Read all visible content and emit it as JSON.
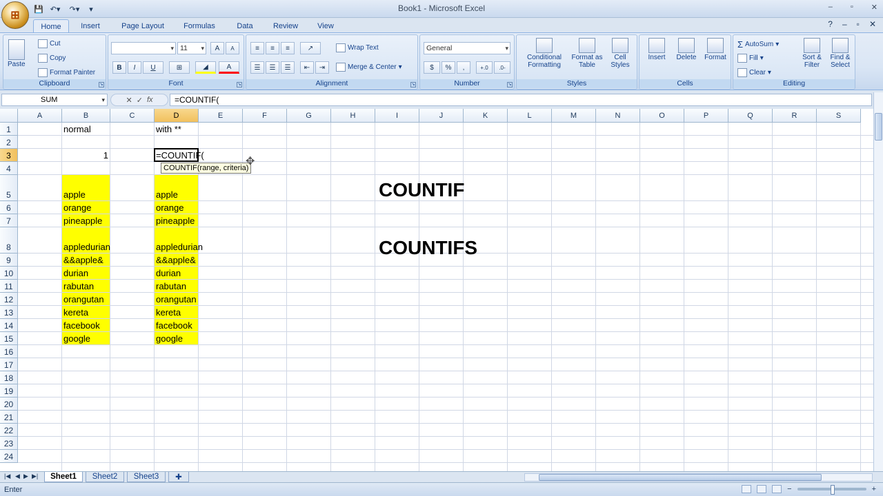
{
  "window": {
    "title": "Book1 - Microsoft Excel",
    "minimize": "–",
    "maximize": "▫",
    "close": "✕"
  },
  "office_button": "⊞",
  "qat": {
    "save": "💾",
    "undo": "↶▾",
    "redo": "↷▾",
    "more": "▾"
  },
  "tabs": [
    "Home",
    "Insert",
    "Page Layout",
    "Formulas",
    "Data",
    "Review",
    "View"
  ],
  "active_tab": "Home",
  "help_icons": {
    "help": "?",
    "min": "–",
    "restore": "▫",
    "close": "✕"
  },
  "ribbon": {
    "clipboard": {
      "label": "Clipboard",
      "paste": "Paste",
      "cut": "Cut",
      "copy": "Copy",
      "format_painter": "Format Painter"
    },
    "font": {
      "label": "Font",
      "font_name": "",
      "font_size": "11",
      "grow": "A",
      "shrink": "A",
      "bold": "B",
      "italic": "I",
      "underline": "U",
      "borders": "⊞",
      "fill": "◢",
      "font_color": "A"
    },
    "alignment": {
      "label": "Alignment",
      "wrap_text": "Wrap Text",
      "merge_center": "Merge & Center"
    },
    "number": {
      "label": "Number",
      "format": "General",
      "currency": "$",
      "percent": "%",
      "comma": ",",
      "inc_decimal": "+.0",
      "dec_decimal": ".0-"
    },
    "styles": {
      "label": "Styles",
      "conditional": "Conditional Formatting",
      "format_table": "Format as Table",
      "cell_styles": "Cell Styles"
    },
    "cells": {
      "label": "Cells",
      "insert": "Insert",
      "delete": "Delete",
      "format": "Format"
    },
    "editing": {
      "label": "Editing",
      "autosum": "AutoSum",
      "fill": "Fill",
      "clear": "Clear",
      "sort_filter": "Sort & Filter",
      "find_select": "Find & Select"
    }
  },
  "formula_bar": {
    "name_box": "SUM",
    "fx_cancel": "✕",
    "fx_enter": "✓",
    "fx_insert": "fx",
    "formula": "=COUNTIF("
  },
  "columns": [
    "A",
    "B",
    "C",
    "D",
    "E",
    "F",
    "G",
    "H",
    "I",
    "J",
    "K",
    "L",
    "M",
    "N",
    "O",
    "P",
    "Q",
    "R",
    "S"
  ],
  "rows": [
    "1",
    "2",
    "3",
    "4",
    "5",
    "6",
    "7",
    "8",
    "9",
    "10",
    "11",
    "12",
    "13",
    "14",
    "15",
    "16",
    "17",
    "18",
    "19",
    "20",
    "21",
    "22",
    "23",
    "24"
  ],
  "cells": {
    "B1": "normal",
    "D1": "with **",
    "B3": "1",
    "D3": "=COUNTIF(",
    "fruits_b": [
      "apple",
      "orange",
      "pineapple",
      "appledurian",
      "&&apple&",
      "durian",
      "rabutan",
      "orangutan",
      "kereta",
      "facebook",
      "google"
    ],
    "fruits_d": [
      "apple",
      "orange",
      "pineapple",
      "appledurian",
      "&&apple&",
      "durian",
      "rabutan",
      "orangutan",
      "kereta",
      "facebook",
      "google"
    ]
  },
  "headings": {
    "countif": "COUNTIF",
    "countifs": "COUNTIFS"
  },
  "tooltip": "COUNTIF(range, criteria)",
  "sheets": [
    "Sheet1",
    "Sheet2",
    "Sheet3"
  ],
  "active_sheet": "Sheet1",
  "status": {
    "mode": "Enter"
  }
}
